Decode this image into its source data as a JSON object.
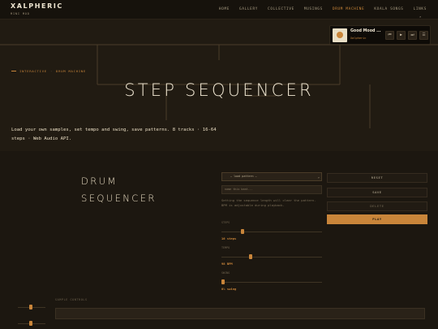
{
  "header": {
    "brand": "XALPHERIC",
    "brand_sub": "MINI MOD",
    "nav": [
      {
        "label": "HOME"
      },
      {
        "label": "GALLERY"
      },
      {
        "label": "COLLECTIVE"
      },
      {
        "label": "MUSINGS"
      },
      {
        "label": "DRUM MACHINE",
        "active": true
      },
      {
        "label": "KOALA SONGS"
      },
      {
        "label": "LINKS"
      }
    ]
  },
  "player": {
    "title": "Good Mood ...",
    "artist": "Xalpheric",
    "prev_icon": "⏮",
    "play_icon": "▶",
    "next_icon": "⏭",
    "menu_icon": "☰"
  },
  "hero": {
    "crumb_section": "INTERACTIVE",
    "crumb_sep": "·",
    "crumb_page": "DRUM MACHINE",
    "title": "STEP SEQUENCER",
    "description": "Load your own samples, set tempo and swing, save patterns. 8 tracks · 16-64 steps · Web Audio API."
  },
  "sequencer": {
    "title_line1": "DRUM",
    "title_line2": "SEQUENCER",
    "pattern_select": "— load pattern —",
    "pattern_name_placeholder": "name this beat...",
    "note": "Setting the sequence length will clear the pattern. BPM is adjustable during playback.",
    "controls": [
      {
        "label": "STEPS",
        "value": "16 steps",
        "level": 0.2
      },
      {
        "label": "TEMPO",
        "value": "98 BPM",
        "level": 0.28
      },
      {
        "label": "SWING",
        "value": "0% swing",
        "level": 0.0
      }
    ],
    "buttons": {
      "reset": "RESET",
      "save": "SAVE",
      "delete": "DELETE",
      "play": "PLAY"
    },
    "sample_label": "SAMPLE CONTROLS"
  },
  "colors": {
    "accent": "#c9853a",
    "background": "#1c1710",
    "hero_background": "#211b12"
  }
}
